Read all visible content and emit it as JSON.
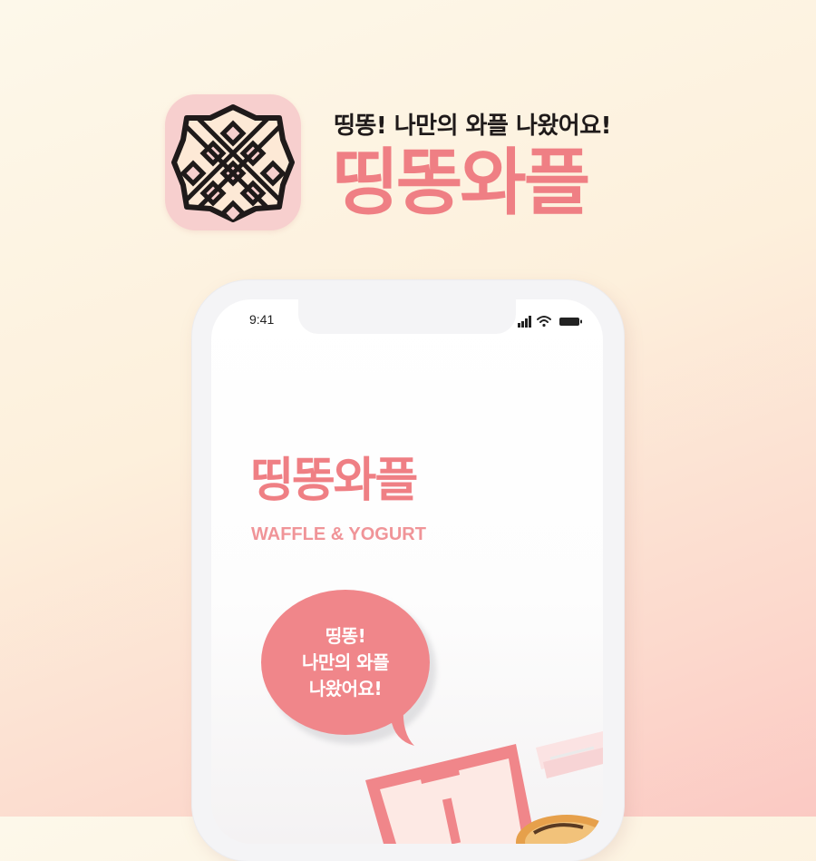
{
  "header": {
    "tagline": "띵똥! 나만의 와플 나왔어요!",
    "brand_title": "띵똥와플",
    "app_icon": "waffle-icon"
  },
  "phone": {
    "status_bar": {
      "time": "9:41",
      "icons": [
        "signal-icon",
        "wifi-icon",
        "battery-icon"
      ]
    },
    "screen": {
      "title": "띵똥와플",
      "subtitle": "WAFFLE & YOGURT",
      "bubble_lines": [
        "띵똥!",
        "나만의 와플",
        "나왔어요!"
      ]
    }
  },
  "colors": {
    "brand_pink": "#ef7f84",
    "bubble_pink": "#f0868a",
    "icon_bg": "#f7cfce",
    "icon_cream": "#fde9d6",
    "icon_outline": "#1f1a1a"
  }
}
